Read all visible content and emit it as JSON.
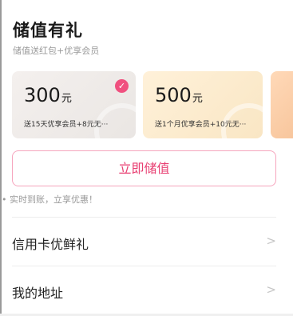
{
  "header": {
    "title": "储值有礼",
    "subtitle": "储值送红包+优享会员"
  },
  "cards": [
    {
      "amount": "300",
      "unit": "元",
      "desc": "送15天优享会员+8元无···",
      "selected": true
    },
    {
      "amount": "500",
      "unit": "元",
      "desc": "送1个月优享会员+10元无···",
      "selected": false
    }
  ],
  "cta": {
    "label": "立即储值"
  },
  "note": "• 实时到账，立享优惠！",
  "menu": [
    {
      "label": "信用卡优鲜礼",
      "chevron": ">"
    },
    {
      "label": "我的地址",
      "chevron": ">"
    }
  ],
  "icons": {
    "check": "check-icon",
    "chevron": "chevron-right-icon"
  },
  "colors": {
    "accent": "#e83f72",
    "check_bg": "#f0507f",
    "card_1": "#f1edea",
    "card_2": "#fcebd0",
    "card_3": "#fbcfa9"
  }
}
